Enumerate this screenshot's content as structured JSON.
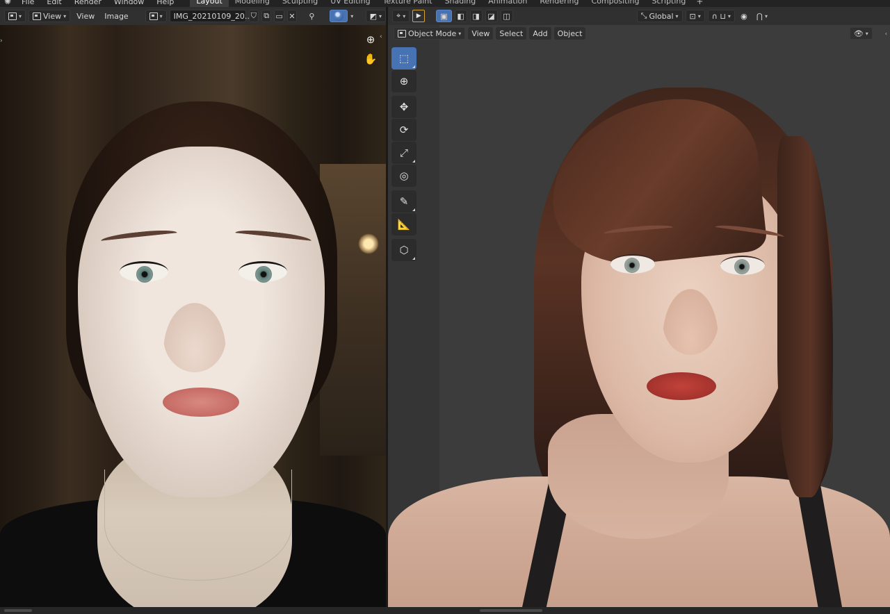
{
  "menu": {
    "items": [
      "File",
      "Edit",
      "Render",
      "Window",
      "Help"
    ]
  },
  "workspaces": {
    "tabs": [
      "Layout",
      "Modeling",
      "Sculpting",
      "UV Editing",
      "Texture Paint",
      "Shading",
      "Animation",
      "Rendering",
      "Compositing",
      "Scripting"
    ],
    "active": "Layout",
    "add_icon": "plus-icon"
  },
  "image_editor": {
    "view_label": "View",
    "menus": [
      "View",
      "Image"
    ],
    "image_name": "IMG_20210109_20...",
    "icons": [
      "editor-type-icon",
      "image-browse-icon",
      "shield-icon",
      "duplicate-icon",
      "folder-icon",
      "close-icon",
      "pin-icon",
      "overlay-sphere-icon",
      "display-channels-icon",
      "zoom-icon",
      "hand-pan-icon"
    ]
  },
  "viewport": {
    "transform_orientation": "Global",
    "mode": "Object Mode",
    "menus": [
      "View",
      "Select",
      "Add",
      "Object"
    ],
    "tools": [
      "select-box-icon",
      "cursor-icon",
      "move-icon",
      "rotate-icon",
      "scale-icon",
      "transform-icon",
      "annotate-icon",
      "measure-icon",
      "add-cube-icon"
    ],
    "accent_color": "#4772b3",
    "header_icons": [
      "transform-pivot-icon",
      "select-mode-icon",
      "snap-icon",
      "proportional-edit-icon",
      "visibility-icon"
    ]
  }
}
